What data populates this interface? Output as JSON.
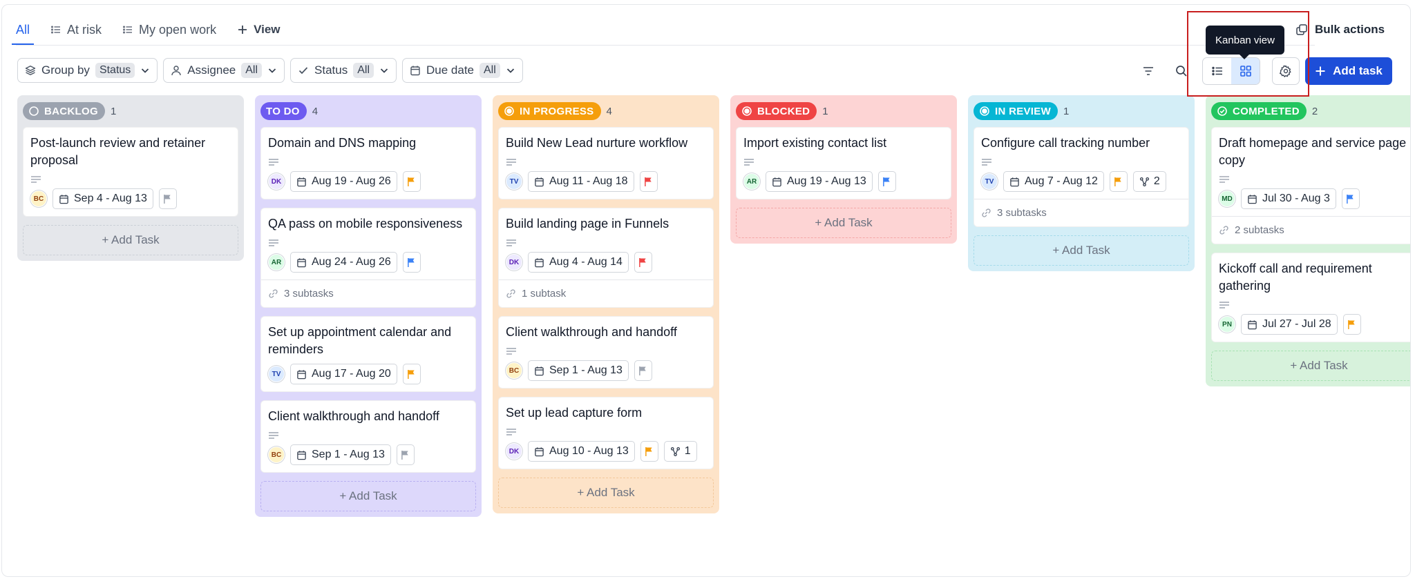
{
  "tabs": [
    {
      "label": "All",
      "active": true,
      "icon": "none"
    },
    {
      "label": "At risk",
      "icon": "list-icon"
    },
    {
      "label": "My open work",
      "icon": "list-icon"
    },
    {
      "label": "View",
      "icon": "plus-icon"
    }
  ],
  "filters": [
    {
      "label": "Group by",
      "value": "Status",
      "icon": "layers-icon"
    },
    {
      "label": "Assignee",
      "value": "All",
      "icon": "user-icon"
    },
    {
      "label": "Status",
      "value": "All",
      "icon": "check-icon"
    },
    {
      "label": "Due date",
      "value": "All",
      "icon": "calendar-icon"
    }
  ],
  "toolbar": {
    "bulk_actions": "Bulk actions",
    "tooltip": "Kanban view",
    "add_task": "Add task"
  },
  "colors": {
    "accent": "#1d4ed8",
    "flag_gray": "#9ca3af",
    "flag_orange": "#f59e0b",
    "flag_blue": "#3b82f6",
    "flag_red": "#ef4444"
  },
  "columns": [
    {
      "status": "BACKLOG",
      "count": "1",
      "add_label": "+ Add Task",
      "cards": [
        {
          "title": "Post-launch review and retainer proposal",
          "avatar": "BC",
          "date": "Sep 4 - Aug 13",
          "flag": "gray"
        }
      ]
    },
    {
      "status": "TO DO",
      "count": "4",
      "add_label": "+ Add Task",
      "cards": [
        {
          "title": "Domain and DNS mapping",
          "avatar": "DK",
          "date": "Aug 19 - Aug 26",
          "flag": "orange",
          "desc": true
        },
        {
          "title": "QA pass on mobile responsiveness",
          "avatar": "AR",
          "date": "Aug 24 - Aug 26",
          "flag": "blue",
          "desc": true,
          "subtasks_label": "3 subtasks"
        },
        {
          "title": "Set up appointment calendar and reminders",
          "avatar": "TV",
          "date": "Aug 17 - Aug 20",
          "flag": "orange",
          "desc": false
        },
        {
          "title": "Client walkthrough and handoff",
          "avatar": "BC",
          "date": "Sep 1 - Aug 13",
          "flag": "gray",
          "desc": true
        }
      ]
    },
    {
      "status": "IN PROGRESS",
      "count": "4",
      "add_label": "+ Add Task",
      "cards": [
        {
          "title": "Build New Lead nurture workflow",
          "avatar": "TV",
          "date": "Aug 11 - Aug 18",
          "flag": "red",
          "desc": true
        },
        {
          "title": "Build landing page in Funnels",
          "avatar": "DK",
          "date": "Aug 4 - Aug 14",
          "flag": "red",
          "desc": true,
          "subtasks_label": "1 subtask"
        },
        {
          "title": "Client walkthrough and handoff",
          "avatar": "BC",
          "date": "Sep 1 - Aug 13",
          "flag": "gray",
          "desc": true
        },
        {
          "title": "Set up lead capture form",
          "avatar": "DK",
          "date": "Aug 10 - Aug 13",
          "flag": "orange",
          "desc": true,
          "subtask_count": "1"
        }
      ]
    },
    {
      "status": "BLOCKED",
      "count": "1",
      "add_label": "+ Add Task",
      "cards": [
        {
          "title": "Import existing contact list",
          "avatar": "AR",
          "date": "Aug 19 - Aug 13",
          "flag": "blue",
          "desc": true
        }
      ]
    },
    {
      "status": "IN REVIEW",
      "count": "1",
      "add_label": "+ Add Task",
      "cards": [
        {
          "title": "Configure call tracking number",
          "avatar": "TV",
          "date": "Aug 7 - Aug 12",
          "flag": "orange",
          "desc": true,
          "subtask_count": "2",
          "subtasks_label": "3 subtasks"
        }
      ]
    },
    {
      "status": "COMPLETED",
      "count": "2",
      "add_label": "+ Add Task",
      "cards": [
        {
          "title": "Draft homepage and service page copy",
          "avatar": "MD",
          "date": "Jul 30 - Aug 3",
          "flag": "blue",
          "desc": true,
          "subtasks_label": "2 subtasks"
        },
        {
          "title": "Kickoff call and requirement gathering",
          "avatar": "PN",
          "date": "Jul 27 - Jul 28",
          "flag": "orange",
          "desc": true
        }
      ]
    }
  ]
}
